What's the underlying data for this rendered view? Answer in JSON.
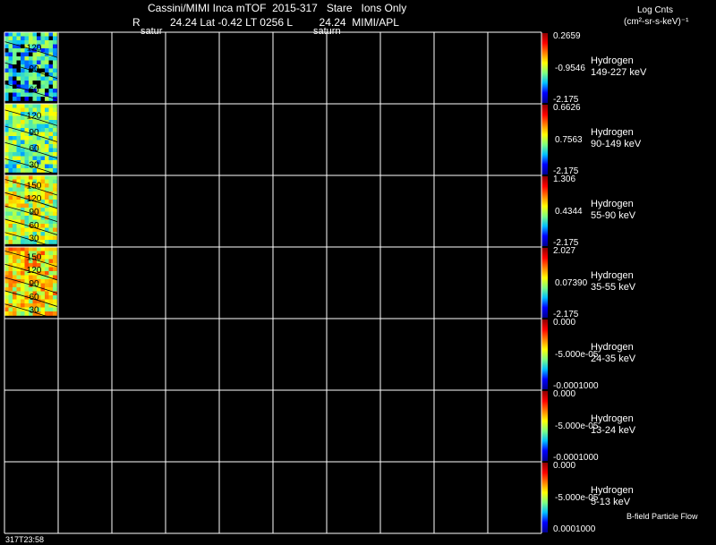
{
  "header": {
    "title": "Cassini/MIMI Inca mTOF  2015-317   Stare   Ions Only",
    "r_label": "R",
    "geo_line": "24.24 Lat -0.42 LT 0256 L         24.24  MIMI/APL",
    "saturn_left": "satur",
    "saturn_right": "saturn",
    "units_title": "Log Cnts",
    "units": "(cm²-sr-s-keV)⁻¹"
  },
  "footer": {
    "time": "317T23:58",
    "legend_note": "B-field Particle Flow"
  },
  "colors": {
    "background": "#000000",
    "grid": "#ffffff",
    "colorbar": [
      "#00008f",
      "#0000ff",
      "#00bfff",
      "#7fff7f",
      "#ffff00",
      "#ff7f00",
      "#ff0000",
      "#8f0000"
    ]
  },
  "chart_data": {
    "type": "heatmap",
    "grid_cols": 10,
    "panels": [
      {
        "species": "Hydrogen",
        "energy": "149-227 keV",
        "max": "0.2659",
        "mid": "-0.9546",
        "min": "-2.175",
        "contours": [
          "120",
          "90",
          "60"
        ],
        "mean_level": 0.35
      },
      {
        "species": "Hydrogen",
        "energy": "90-149 keV",
        "max": "0.6626",
        "mid": "0.7563",
        "min": "-2.175",
        "contours": [
          "120",
          "90",
          "60",
          "30"
        ],
        "mean_level": 0.45
      },
      {
        "species": "Hydrogen",
        "energy": "55-90 keV",
        "max": "1.306",
        "mid": "0.4344",
        "min": "-2.175",
        "contours": [
          "150",
          "120",
          "90",
          "60",
          "30"
        ],
        "mean_level": 0.55
      },
      {
        "species": "Hydrogen",
        "energy": "35-55 keV",
        "max": "2.027",
        "mid": "0.07390",
        "min": "-2.175",
        "contours": [
          "150",
          "120",
          "90",
          "60",
          "30"
        ],
        "mean_level": 0.62
      },
      {
        "species": "Hydrogen",
        "energy": "24-35 keV",
        "max": "0.000",
        "mid": "-5.000e-05",
        "min": "-0.0001000",
        "contours": [],
        "mean_level": null
      },
      {
        "species": "Hydrogen",
        "energy": "13-24 keV",
        "max": "0.000",
        "mid": "-5.000e-05",
        "min": "-0.0001000",
        "contours": [],
        "mean_level": null
      },
      {
        "species": "Hydrogen",
        "energy": "5-13 keV",
        "max": "0.000",
        "mid": "-5.000e-05",
        "min": "0.0001000",
        "contours": [],
        "mean_level": null
      }
    ]
  }
}
